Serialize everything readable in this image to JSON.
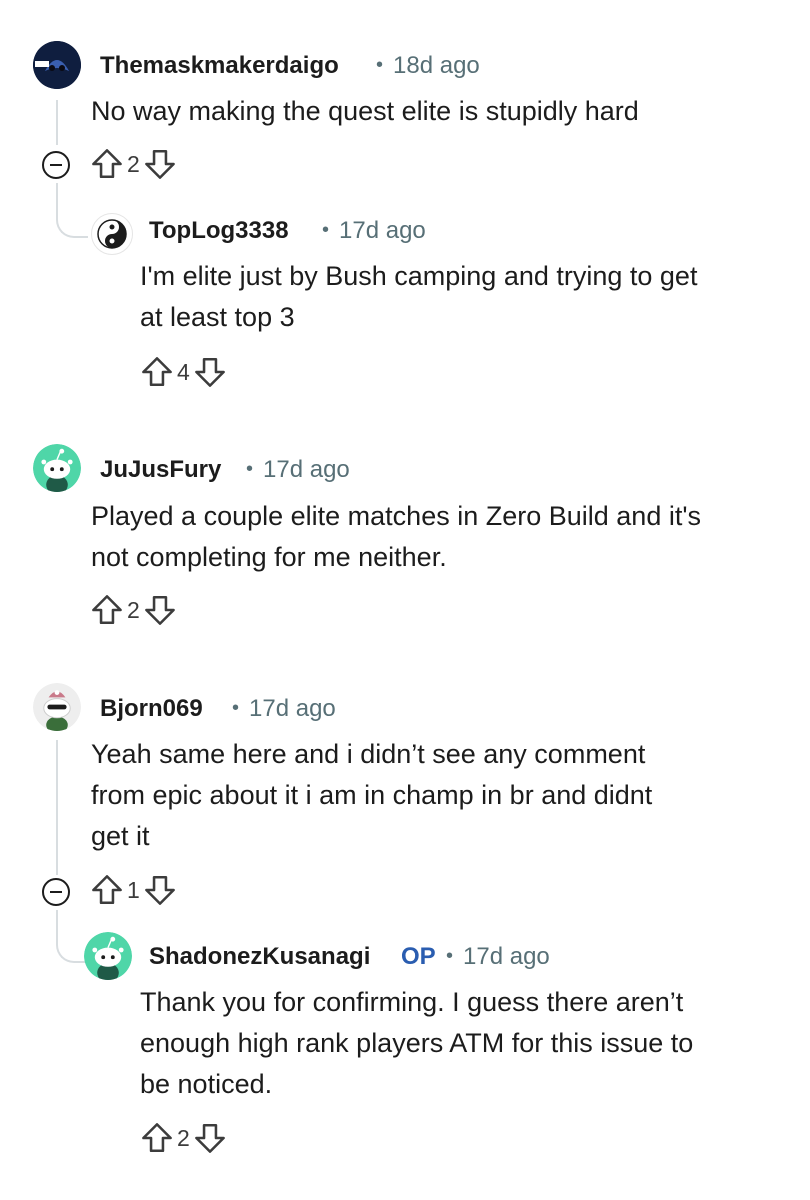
{
  "comments": [
    {
      "user": "Themaskmakerdaigo",
      "time": "18d ago",
      "lines": [
        "No way making the quest elite is stupidly hard"
      ],
      "score": "2"
    },
    {
      "user": "TopLog3338",
      "time": "17d ago",
      "lines": [
        "I'm elite just by Bush camping and trying to get",
        "at least top 3"
      ],
      "score": "4"
    },
    {
      "user": "JuJusFury",
      "time": "17d ago",
      "lines": [
        "Played a couple elite matches in Zero Build and it's",
        "not completing for me neither."
      ],
      "score": "2"
    },
    {
      "user": "Bjorn069",
      "time": "17d ago",
      "lines": [
        "Yeah same here and i didn’t see any comment",
        "from epic about it i am in champ in br and didnt",
        "get it"
      ],
      "score": "1"
    },
    {
      "user": "ShadonezKusanagi",
      "op_badge": "OP",
      "time": "17d ago",
      "lines": [
        "Thank you for confirming. I guess there aren’t",
        "enough high rank players ATM for this issue to",
        "be noticed."
      ],
      "score": "2"
    }
  ],
  "separator": "•",
  "icons": {
    "upvote": "upvote-arrow-icon",
    "downvote": "downvote-arrow-icon",
    "collapse": "collapse-minus-icon"
  },
  "colors": {
    "username": "#1c1c1c",
    "meta": "#576f76",
    "op_badge": "#2a5db0",
    "thread_line": "#d8dde0",
    "snoo_green": "#4fd6a8"
  }
}
